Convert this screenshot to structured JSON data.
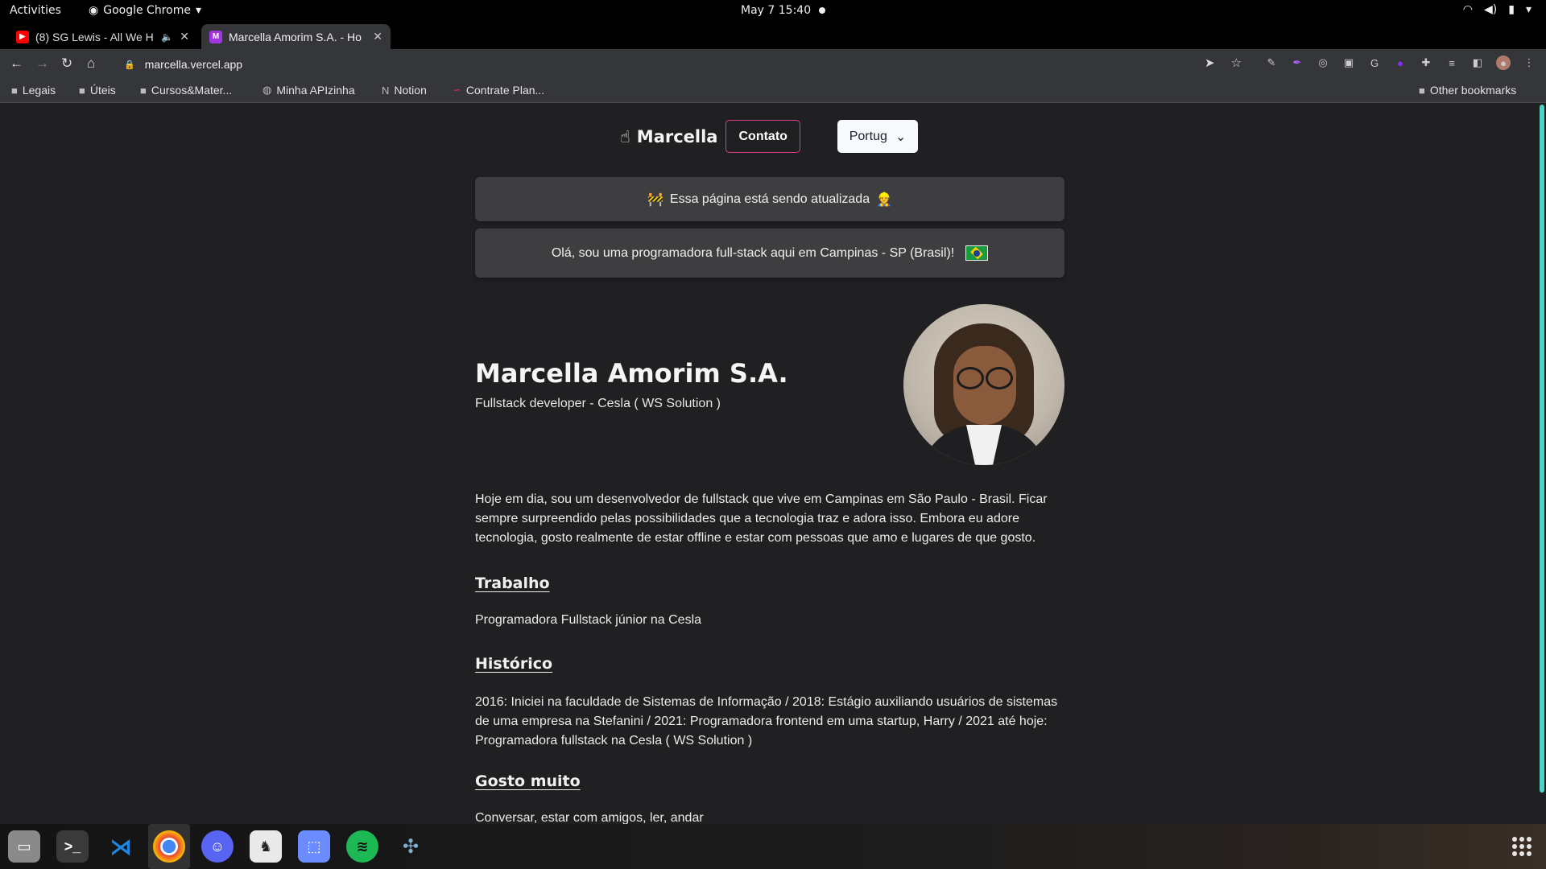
{
  "system": {
    "activities": "Activities",
    "app_name": "Google Chrome",
    "clock": "May 7  15:40"
  },
  "tabs": [
    {
      "title": "(8) SG Lewis - All We H",
      "favicon": "youtube-icon",
      "favicon_color": "#ff0000"
    },
    {
      "title": "Marcella Amorim S.A. - Ho",
      "favicon": "m-icon",
      "favicon_color": "#9f36e0"
    }
  ],
  "omnibox": {
    "url": "marcella.vercel.app"
  },
  "bookmarks": [
    {
      "label": "Legais",
      "icon": "folder-icon"
    },
    {
      "label": "Úteis",
      "icon": "folder-icon"
    },
    {
      "label": "Cursos&Mater...",
      "icon": "folder-icon"
    },
    {
      "label": "Minha APIzinha",
      "icon": "globe-icon"
    },
    {
      "label": "Notion",
      "icon": "notion-icon"
    },
    {
      "label": "Contrate Plan...",
      "icon": "link-icon"
    }
  ],
  "other_bookmarks": "Other bookmarks",
  "site": {
    "brand": "Marcella",
    "contact_label": "Contato",
    "language_selected": "Portug",
    "banner_update": "Essa página está sendo atualizada",
    "banner_update_emoji_left": "🚧",
    "banner_update_emoji_right": "👷",
    "banner_intro": "Olá, sou uma programadora full-stack aqui em Campinas - SP (Brasil)!",
    "name": "Marcella Amorim S.A.",
    "role": "Fullstack developer - Cesla ( WS Solution )",
    "bio": "Hoje em dia, sou um desenvolvedor de fullstack que vive em Campinas em São Paulo - Brasil. Ficar sempre surpreendido pelas possibilidades que a tecnologia traz e adora isso. Embora eu adore tecnologia, gosto realmente de estar offline e estar com pessoas que amo e lugares de que gosto.",
    "work_heading": "Trabalho",
    "work_text": "Programadora Fullstack júnior na Cesla",
    "history_heading": "Histórico",
    "history_text": "2016: Iniciei na faculdade de Sistemas de Informação / 2018: Estágio auxiliando usuários de sistemas de uma empresa na Stefanini / 2021: Programadora frontend em uma startup, Harry / 2021 até hoje: Programadora fullstack na Cesla ( WS Solution )",
    "likes_heading": "Gosto muito",
    "likes_text": "Conversar, estar com amigos, ler, andar"
  },
  "colors": {
    "accent_pink": "#d53f8c",
    "scrollbar": "#4fd1c5",
    "background": "#202023"
  },
  "dock": [
    {
      "name": "files-icon",
      "color": "#8a8a8a"
    },
    {
      "name": "terminal-icon",
      "color": "#3a3a3a"
    },
    {
      "name": "vscode-icon",
      "color": "#1e88e5"
    },
    {
      "name": "chrome-icon",
      "color": "#4caf50"
    },
    {
      "name": "discord-icon",
      "color": "#5865f2"
    },
    {
      "name": "inkscape-icon",
      "color": "#e9e9e9"
    },
    {
      "name": "screenshot-icon",
      "color": "#6b8cff"
    },
    {
      "name": "spotify-icon",
      "color": "#1db954"
    },
    {
      "name": "network-icon",
      "color": "#3f6e8a"
    }
  ]
}
